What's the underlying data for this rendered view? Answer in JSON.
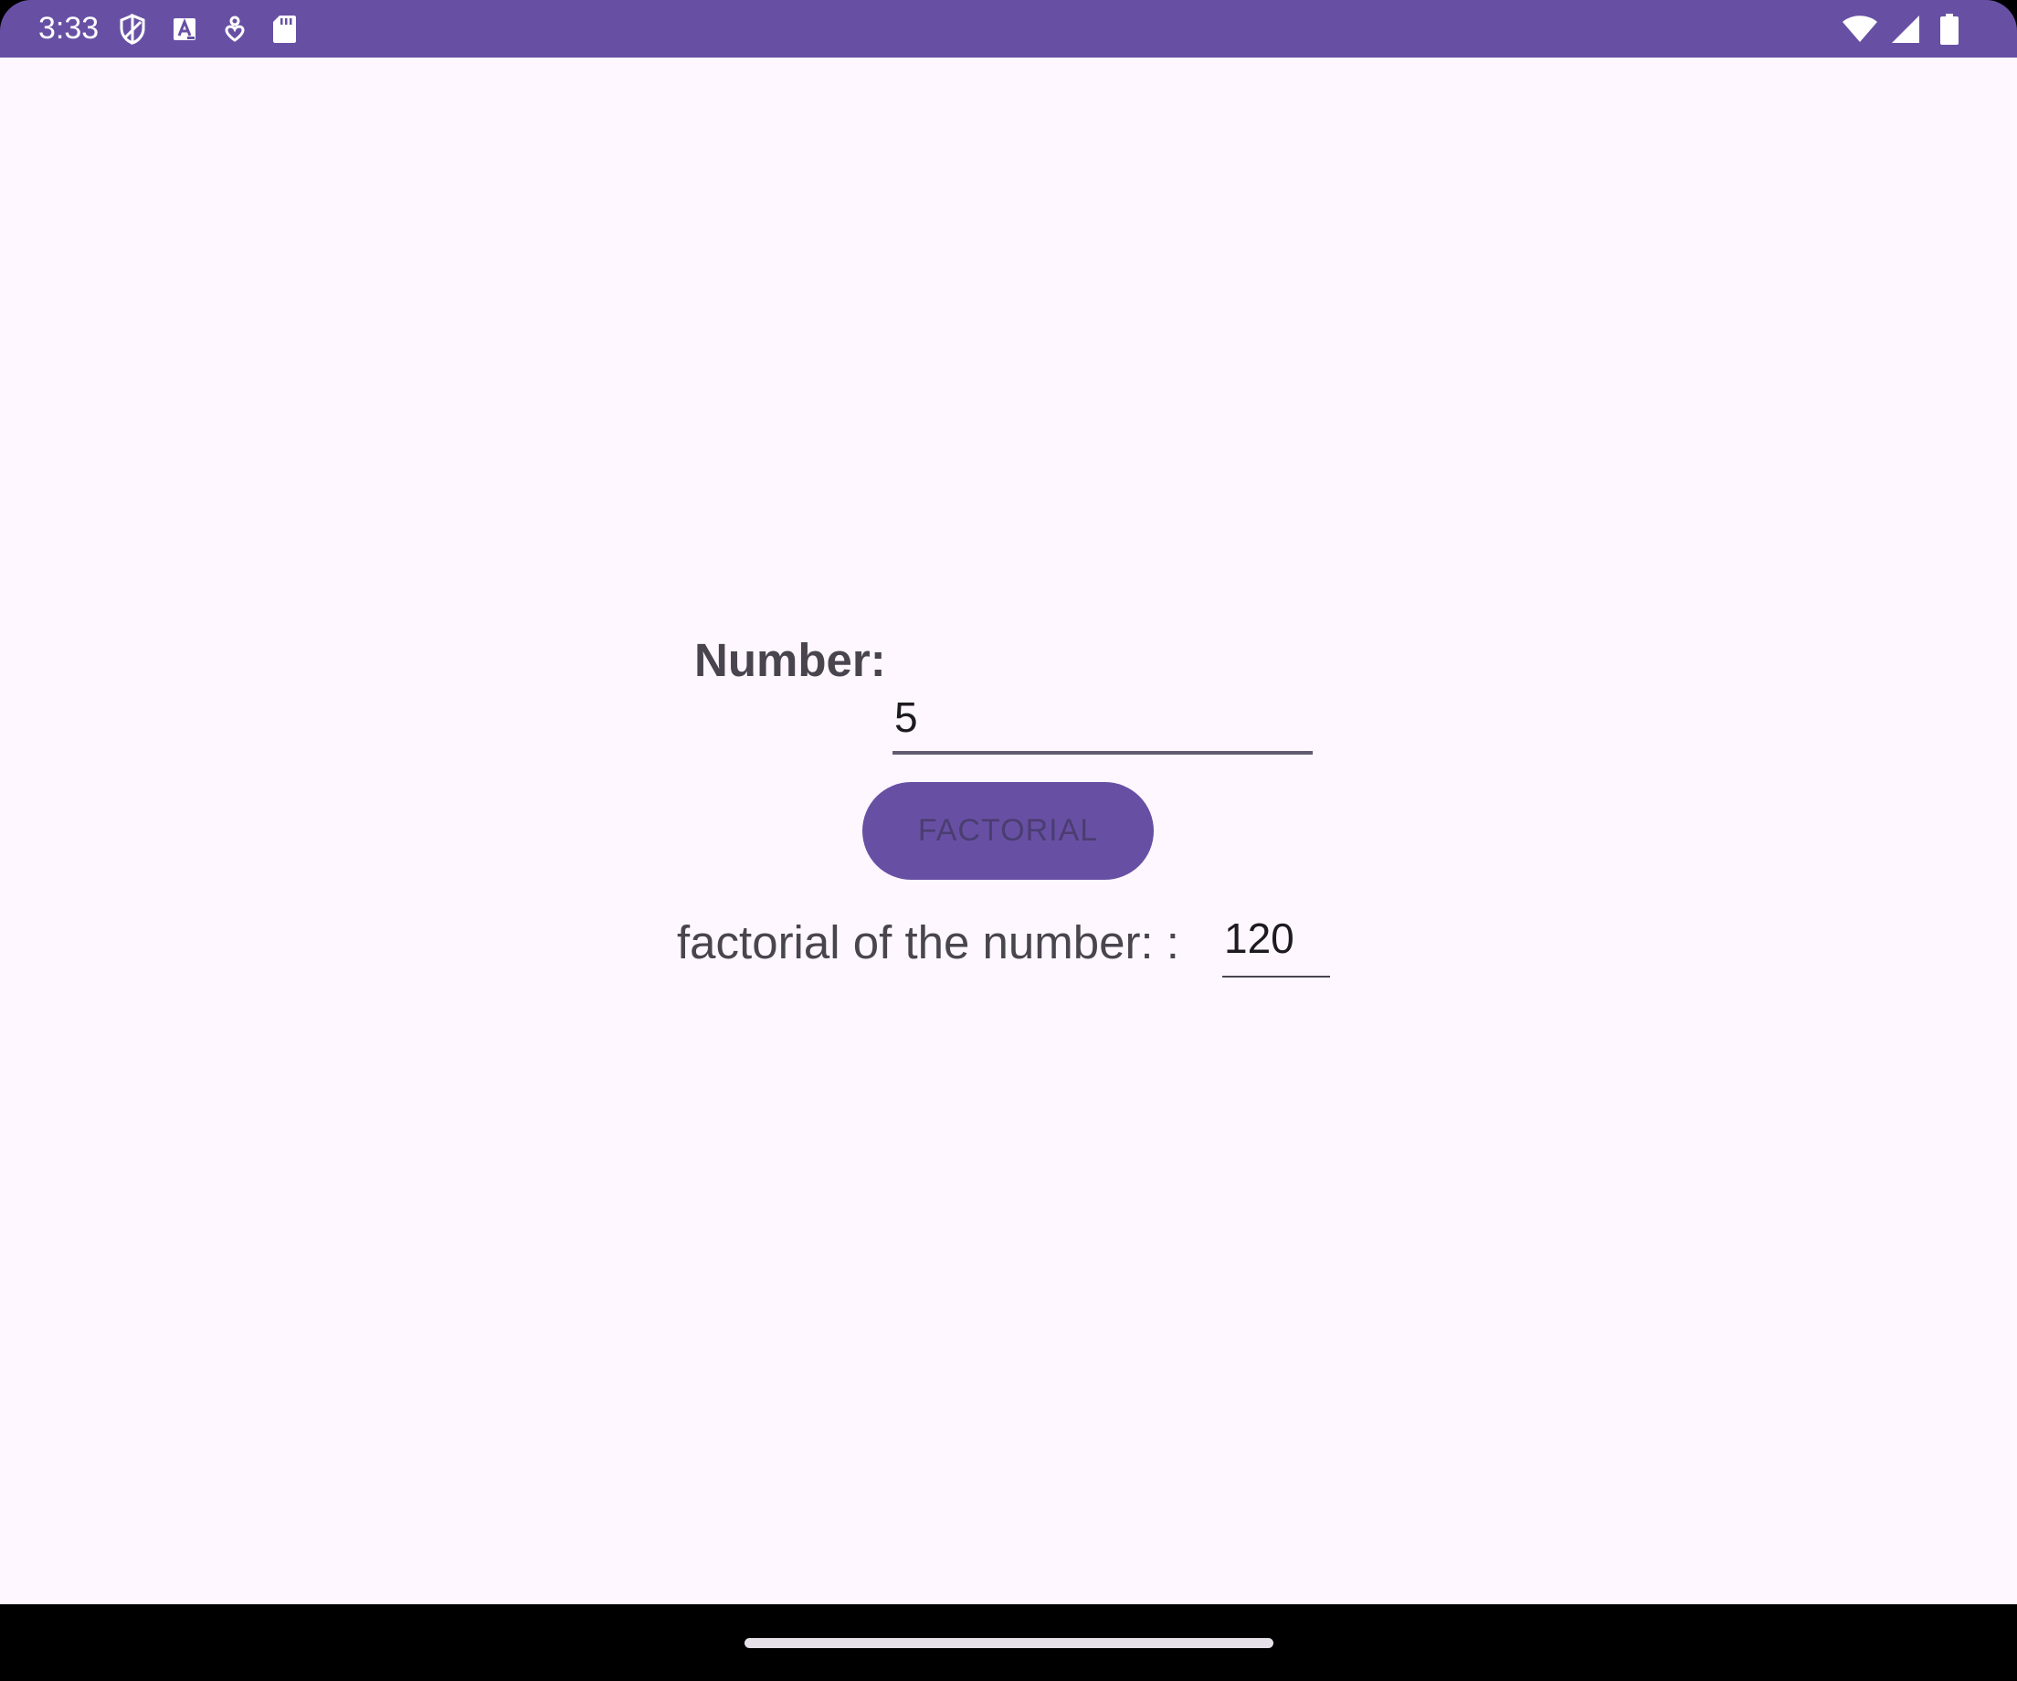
{
  "status_bar": {
    "time": "3:33",
    "background_color": "#6750A4",
    "left_icons": [
      "shield-icon",
      "text-a-icon",
      "location-heart-icon",
      "sd-card-icon"
    ],
    "right_icons": [
      "wifi-icon",
      "cellular-signal-icon",
      "battery-icon"
    ]
  },
  "form": {
    "number_label": "Number:",
    "number_value": "5",
    "button_label": "FACTORIAL",
    "result_label": "factorial of the number: :",
    "result_value": "120"
  },
  "colors": {
    "primary": "#6750A4",
    "background": "#FEF7FF",
    "label_text": "#49454F",
    "navigation_bar": "#000000"
  }
}
